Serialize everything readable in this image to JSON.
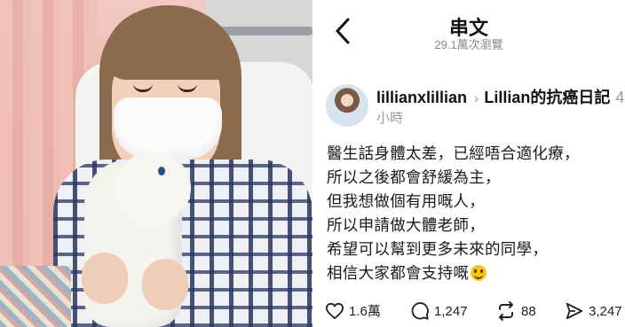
{
  "header": {
    "title": "串文",
    "views": "29.1萬次瀏覽"
  },
  "post": {
    "username": "lillianxlillian",
    "topic": "Lillian的抗癌日記",
    "topic_extra": "4",
    "time": "小時",
    "lines": [
      "醫生話身體太差，已經唔合適化療，",
      "所以之後都會舒緩為主，",
      "但我想做個有用嘅人，",
      "所以申請做大體老師，",
      "希望可以幫到更多未來的同學，",
      "相信大家都會支持嘅"
    ],
    "emoji": "smiling-face-icon"
  },
  "actions": {
    "likes": "1.6萬",
    "comments": "1,247",
    "reposts": "88",
    "shares": "3,247"
  },
  "photo": {
    "description_icon": "photo-of-patient"
  }
}
